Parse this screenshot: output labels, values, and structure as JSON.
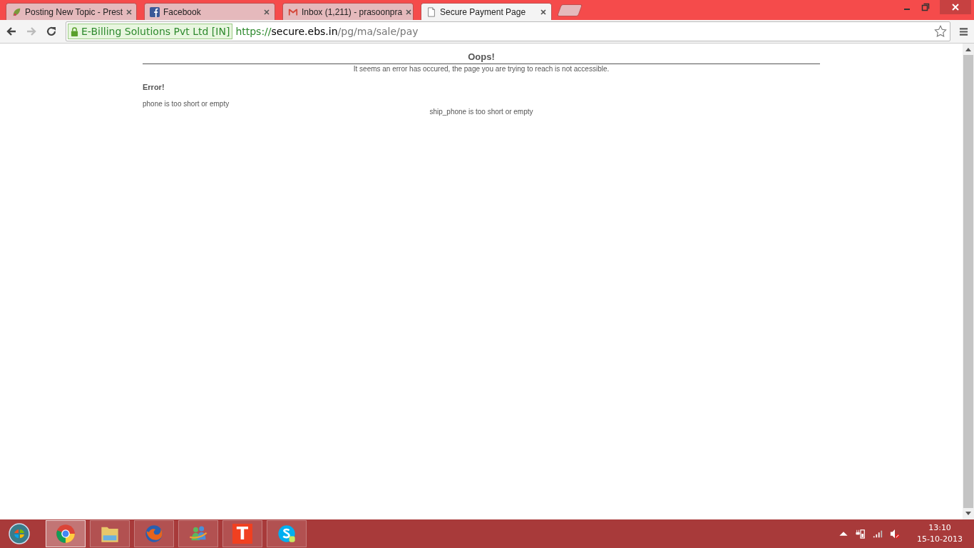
{
  "tabs": [
    {
      "kind": "leaf",
      "title": "Posting New Topic - Prest",
      "selected": false
    },
    {
      "kind": "facebook",
      "title": "Facebook",
      "selected": false
    },
    {
      "kind": "mail",
      "title": "Inbox (1,211) - prasoonpra",
      "selected": false
    },
    {
      "kind": "page",
      "title": "Secure Payment Page",
      "selected": true
    }
  ],
  "address": {
    "identity": "E-Billing Solutions Pvt Ltd [IN]",
    "scheme": "https://",
    "host": "secure.ebs.in",
    "path": "/pg/ma/sale/pay"
  },
  "page": {
    "title": "Oops!",
    "subtitle": "It seems an error has occured, the page you are trying to reach is not accessible.",
    "error_heading": "Error!",
    "errors": [
      "phone is too short or empty",
      "ship_phone is too short or empty"
    ]
  },
  "taskbar": {
    "apps": [
      {
        "kind": "chrome",
        "selected": true
      },
      {
        "kind": "folder",
        "selected": false
      },
      {
        "kind": "firefox",
        "selected": false
      },
      {
        "kind": "messenger",
        "selected": false
      },
      {
        "kind": "letter",
        "label": "T",
        "selected": false
      },
      {
        "kind": "skype",
        "selected": false
      }
    ],
    "time": "13:10",
    "date": "15-10-2013"
  }
}
